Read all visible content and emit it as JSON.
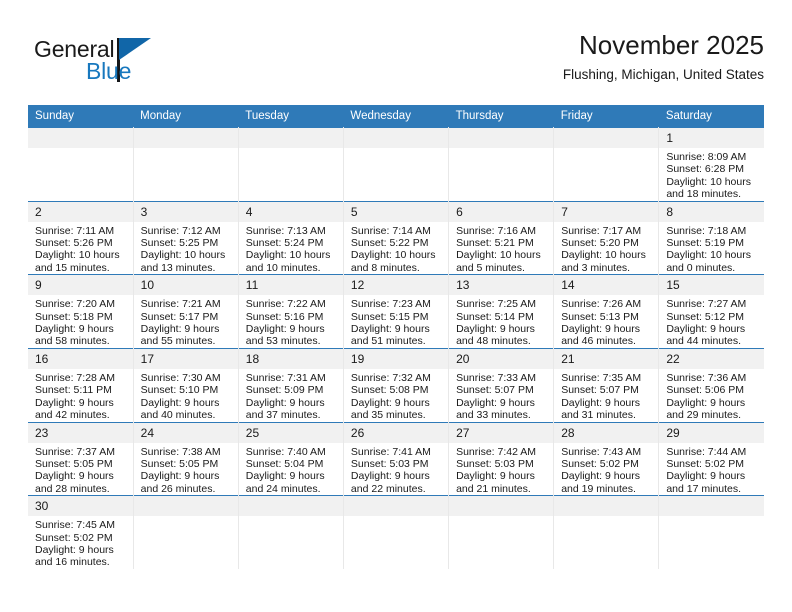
{
  "brand": {
    "name_part1": "General",
    "name_part2": "Blue",
    "flag_icon": "blue-flag-icon"
  },
  "header": {
    "title": "November 2025",
    "subtitle": "Flushing, Michigan, United States"
  },
  "theme": {
    "header_blue": "#2f7ab8",
    "daynum_gray": "#f1f1f1",
    "brand_blue": "#1878be",
    "text": "#1a1a1a"
  },
  "weekdays": [
    "Sunday",
    "Monday",
    "Tuesday",
    "Wednesday",
    "Thursday",
    "Friday",
    "Saturday"
  ],
  "labels": {
    "sunrise": "Sunrise:",
    "sunset": "Sunset:",
    "daylight": "Daylight:"
  },
  "weeks": [
    [
      {
        "day": "",
        "empty": true
      },
      {
        "day": "",
        "empty": true
      },
      {
        "day": "",
        "empty": true
      },
      {
        "day": "",
        "empty": true
      },
      {
        "day": "",
        "empty": true
      },
      {
        "day": "",
        "empty": true
      },
      {
        "day": "1",
        "sunrise": "Sunrise: 8:09 AM",
        "sunset": "Sunset: 6:28 PM",
        "daylight1": "Daylight: 10 hours",
        "daylight2": "and 18 minutes."
      }
    ],
    [
      {
        "day": "2",
        "sunrise": "Sunrise: 7:11 AM",
        "sunset": "Sunset: 5:26 PM",
        "daylight1": "Daylight: 10 hours",
        "daylight2": "and 15 minutes."
      },
      {
        "day": "3",
        "sunrise": "Sunrise: 7:12 AM",
        "sunset": "Sunset: 5:25 PM",
        "daylight1": "Daylight: 10 hours",
        "daylight2": "and 13 minutes."
      },
      {
        "day": "4",
        "sunrise": "Sunrise: 7:13 AM",
        "sunset": "Sunset: 5:24 PM",
        "daylight1": "Daylight: 10 hours",
        "daylight2": "and 10 minutes."
      },
      {
        "day": "5",
        "sunrise": "Sunrise: 7:14 AM",
        "sunset": "Sunset: 5:22 PM",
        "daylight1": "Daylight: 10 hours",
        "daylight2": "and 8 minutes."
      },
      {
        "day": "6",
        "sunrise": "Sunrise: 7:16 AM",
        "sunset": "Sunset: 5:21 PM",
        "daylight1": "Daylight: 10 hours",
        "daylight2": "and 5 minutes."
      },
      {
        "day": "7",
        "sunrise": "Sunrise: 7:17 AM",
        "sunset": "Sunset: 5:20 PM",
        "daylight1": "Daylight: 10 hours",
        "daylight2": "and 3 minutes."
      },
      {
        "day": "8",
        "sunrise": "Sunrise: 7:18 AM",
        "sunset": "Sunset: 5:19 PM",
        "daylight1": "Daylight: 10 hours",
        "daylight2": "and 0 minutes."
      }
    ],
    [
      {
        "day": "9",
        "sunrise": "Sunrise: 7:20 AM",
        "sunset": "Sunset: 5:18 PM",
        "daylight1": "Daylight: 9 hours",
        "daylight2": "and 58 minutes."
      },
      {
        "day": "10",
        "sunrise": "Sunrise: 7:21 AM",
        "sunset": "Sunset: 5:17 PM",
        "daylight1": "Daylight: 9 hours",
        "daylight2": "and 55 minutes."
      },
      {
        "day": "11",
        "sunrise": "Sunrise: 7:22 AM",
        "sunset": "Sunset: 5:16 PM",
        "daylight1": "Daylight: 9 hours",
        "daylight2": "and 53 minutes."
      },
      {
        "day": "12",
        "sunrise": "Sunrise: 7:23 AM",
        "sunset": "Sunset: 5:15 PM",
        "daylight1": "Daylight: 9 hours",
        "daylight2": "and 51 minutes."
      },
      {
        "day": "13",
        "sunrise": "Sunrise: 7:25 AM",
        "sunset": "Sunset: 5:14 PM",
        "daylight1": "Daylight: 9 hours",
        "daylight2": "and 48 minutes."
      },
      {
        "day": "14",
        "sunrise": "Sunrise: 7:26 AM",
        "sunset": "Sunset: 5:13 PM",
        "daylight1": "Daylight: 9 hours",
        "daylight2": "and 46 minutes."
      },
      {
        "day": "15",
        "sunrise": "Sunrise: 7:27 AM",
        "sunset": "Sunset: 5:12 PM",
        "daylight1": "Daylight: 9 hours",
        "daylight2": "and 44 minutes."
      }
    ],
    [
      {
        "day": "16",
        "sunrise": "Sunrise: 7:28 AM",
        "sunset": "Sunset: 5:11 PM",
        "daylight1": "Daylight: 9 hours",
        "daylight2": "and 42 minutes."
      },
      {
        "day": "17",
        "sunrise": "Sunrise: 7:30 AM",
        "sunset": "Sunset: 5:10 PM",
        "daylight1": "Daylight: 9 hours",
        "daylight2": "and 40 minutes."
      },
      {
        "day": "18",
        "sunrise": "Sunrise: 7:31 AM",
        "sunset": "Sunset: 5:09 PM",
        "daylight1": "Daylight: 9 hours",
        "daylight2": "and 37 minutes."
      },
      {
        "day": "19",
        "sunrise": "Sunrise: 7:32 AM",
        "sunset": "Sunset: 5:08 PM",
        "daylight1": "Daylight: 9 hours",
        "daylight2": "and 35 minutes."
      },
      {
        "day": "20",
        "sunrise": "Sunrise: 7:33 AM",
        "sunset": "Sunset: 5:07 PM",
        "daylight1": "Daylight: 9 hours",
        "daylight2": "and 33 minutes."
      },
      {
        "day": "21",
        "sunrise": "Sunrise: 7:35 AM",
        "sunset": "Sunset: 5:07 PM",
        "daylight1": "Daylight: 9 hours",
        "daylight2": "and 31 minutes."
      },
      {
        "day": "22",
        "sunrise": "Sunrise: 7:36 AM",
        "sunset": "Sunset: 5:06 PM",
        "daylight1": "Daylight: 9 hours",
        "daylight2": "and 29 minutes."
      }
    ],
    [
      {
        "day": "23",
        "sunrise": "Sunrise: 7:37 AM",
        "sunset": "Sunset: 5:05 PM",
        "daylight1": "Daylight: 9 hours",
        "daylight2": "and 28 minutes."
      },
      {
        "day": "24",
        "sunrise": "Sunrise: 7:38 AM",
        "sunset": "Sunset: 5:05 PM",
        "daylight1": "Daylight: 9 hours",
        "daylight2": "and 26 minutes."
      },
      {
        "day": "25",
        "sunrise": "Sunrise: 7:40 AM",
        "sunset": "Sunset: 5:04 PM",
        "daylight1": "Daylight: 9 hours",
        "daylight2": "and 24 minutes."
      },
      {
        "day": "26",
        "sunrise": "Sunrise: 7:41 AM",
        "sunset": "Sunset: 5:03 PM",
        "daylight1": "Daylight: 9 hours",
        "daylight2": "and 22 minutes."
      },
      {
        "day": "27",
        "sunrise": "Sunrise: 7:42 AM",
        "sunset": "Sunset: 5:03 PM",
        "daylight1": "Daylight: 9 hours",
        "daylight2": "and 21 minutes."
      },
      {
        "day": "28",
        "sunrise": "Sunrise: 7:43 AM",
        "sunset": "Sunset: 5:02 PM",
        "daylight1": "Daylight: 9 hours",
        "daylight2": "and 19 minutes."
      },
      {
        "day": "29",
        "sunrise": "Sunrise: 7:44 AM",
        "sunset": "Sunset: 5:02 PM",
        "daylight1": "Daylight: 9 hours",
        "daylight2": "and 17 minutes."
      }
    ],
    [
      {
        "day": "30",
        "sunrise": "Sunrise: 7:45 AM",
        "sunset": "Sunset: 5:02 PM",
        "daylight1": "Daylight: 9 hours",
        "daylight2": "and 16 minutes."
      },
      {
        "day": "",
        "empty": true
      },
      {
        "day": "",
        "empty": true
      },
      {
        "day": "",
        "empty": true
      },
      {
        "day": "",
        "empty": true
      },
      {
        "day": "",
        "empty": true
      },
      {
        "day": "",
        "empty": true
      }
    ]
  ]
}
